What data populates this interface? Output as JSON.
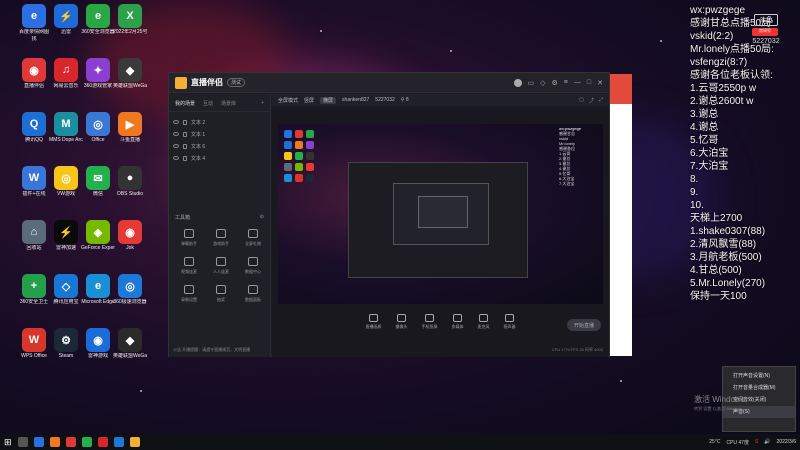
{
  "desktop_icons": [
    {
      "label": "百度亲情网图",
      "sub": "找",
      "color": "#2b6fe0",
      "glyph": "e"
    },
    {
      "label": "迅雷",
      "color": "#1e6bd8",
      "glyph": "⚡"
    },
    {
      "label": "360安全浏览器",
      "color": "#28a745",
      "glyph": "e"
    },
    {
      "label": "2022年2月25号表格",
      "color": "#2aa14a",
      "glyph": "X"
    },
    {
      "label": "直播伴侣",
      "color": "#e03838",
      "glyph": "◉"
    },
    {
      "label": "网易云音乐",
      "color": "#d8262b",
      "glyph": "♫"
    },
    {
      "label": "360游戏管家",
      "color": "#8a3fd1",
      "glyph": "✦"
    },
    {
      "label": "英雄联盟WeGame",
      "color": "#3a3a3a",
      "glyph": "◆"
    },
    {
      "label": "腾讯QQ",
      "color": "#1d6fd6",
      "glyph": "Q"
    },
    {
      "label": "MMS Dope Arca...",
      "color": "#1a8fa0",
      "glyph": "M"
    },
    {
      "label": "Office",
      "color": "#3a78d6",
      "glyph": "◎"
    },
    {
      "label": "斗鱼直播",
      "color": "#f0781e",
      "glyph": "▶"
    },
    {
      "label": "插件+在线",
      "color": "#3a76d8",
      "glyph": "W"
    },
    {
      "label": "VW游戏",
      "color": "#f5c518",
      "glyph": "◎"
    },
    {
      "label": "微信",
      "color": "#22b14c",
      "glyph": "✉"
    },
    {
      "label": "OBS Studio",
      "color": "#333",
      "glyph": "●"
    },
    {
      "label": "回收站",
      "color": "#5a6b7a",
      "glyph": "⌂"
    },
    {
      "label": "雷神加速",
      "color": "#0a0a0a",
      "glyph": "⚡"
    },
    {
      "label": "GeForce Experience",
      "color": "#76b900",
      "glyph": "◈"
    },
    {
      "label": "Jok",
      "color": "#e53935",
      "glyph": "◉"
    },
    {
      "label": "360安全卫士",
      "color": "#22a04a",
      "glyph": "+"
    },
    {
      "label": "腾讯应用宝",
      "color": "#1976d2",
      "glyph": "◇"
    },
    {
      "label": "Microsoft Edge",
      "color": "#1b8fd6",
      "glyph": "e"
    },
    {
      "label": "360极速浏览器",
      "color": "#1d78d8",
      "glyph": "◎"
    },
    {
      "label": "WPS Office",
      "color": "#d8362b",
      "glyph": "W"
    },
    {
      "label": "Steam",
      "color": "#1b2838",
      "glyph": "⚙"
    },
    {
      "label": "雷神游戏",
      "color": "#1b6bd8",
      "glyph": "◉"
    },
    {
      "label": "英雄联盟WeGame",
      "color": "#2a2a2a",
      "glyph": "◆"
    }
  ],
  "app": {
    "title": "直播伴侣",
    "version": "测试"
  },
  "left_tabs": [
    "我的场景",
    "互动",
    "场景库"
  ],
  "scenes": [
    "文本 2",
    "文本 1",
    "文本 6",
    "文本 4"
  ],
  "tools": {
    "header": "工具箱",
    "items": [
      "弹幕助手",
      "游戏助手",
      "全屏礼物",
      "视频连麦",
      "人人连麦",
      "数据中心",
      "录制设置",
      "抽奖",
      "数据面板"
    ]
  },
  "notice": "公告 开播提醒：请遵守直播规范，文明直播",
  "subbar": {
    "label1": "全屏模式",
    "label2": "竖屏",
    "tag": "横屏",
    "user": "shanken827",
    "id": "5227032",
    "count": "8"
  },
  "preview": {
    "watermark": "wx:pwzgege",
    "side_lines": [
      "感谢甘总",
      "vskid",
      "Mr.lonely",
      "感谢各位",
      "1.云哥",
      "2.谢总",
      "3.谢总",
      "4.谢总",
      "5.忆哥",
      "6.大泊宝",
      "7.大泊宝"
    ]
  },
  "bottom_tools": [
    "直播画质",
    "摄像头",
    "手机投屏",
    "多媒体",
    "麦克风",
    "扬声器"
  ],
  "live_button": "开始直播",
  "status_line": "CPU 17%  FPS 30  码率 4000",
  "overlay": {
    "watermark": "wx:pwzgege",
    "lines": [
      "感谢甘总点播50局:",
      "vskid(2:2)",
      "Mr.lonely点播50局:",
      "vsfengzi(8:7)",
      "感谢各位老板认领:",
      "1.云哥2550p w",
      "2.谢总2600t w",
      "3.谢总",
      "4.谢总",
      "5.忆哥",
      "6.大泊宝",
      "7.大泊宝",
      "8.",
      "9.",
      "10.",
      "天梯上2700",
      "1.shake0307(88)",
      "2.清风飘雪(88)",
      "3.月航老板(500)",
      "4.甘总(500)",
      "5.Mr.Lonely(270)",
      "保持一天100"
    ],
    "fish_top": "斗鱼",
    "fish_label": "房间号",
    "fish_num": "5227032"
  },
  "context_menu": [
    "打开声音设置(N)",
    "打开音量合成器(M)",
    "空间音效(关闭)",
    "声音(S)"
  ],
  "activation": {
    "line1": "激活 Windows",
    "line2": "转到\"设置\"以激活 Windows。"
  },
  "taskbar": {
    "temp": "25°C",
    "cpu": "CPU 47度",
    "time": "",
    "date": "2022/3/6"
  }
}
